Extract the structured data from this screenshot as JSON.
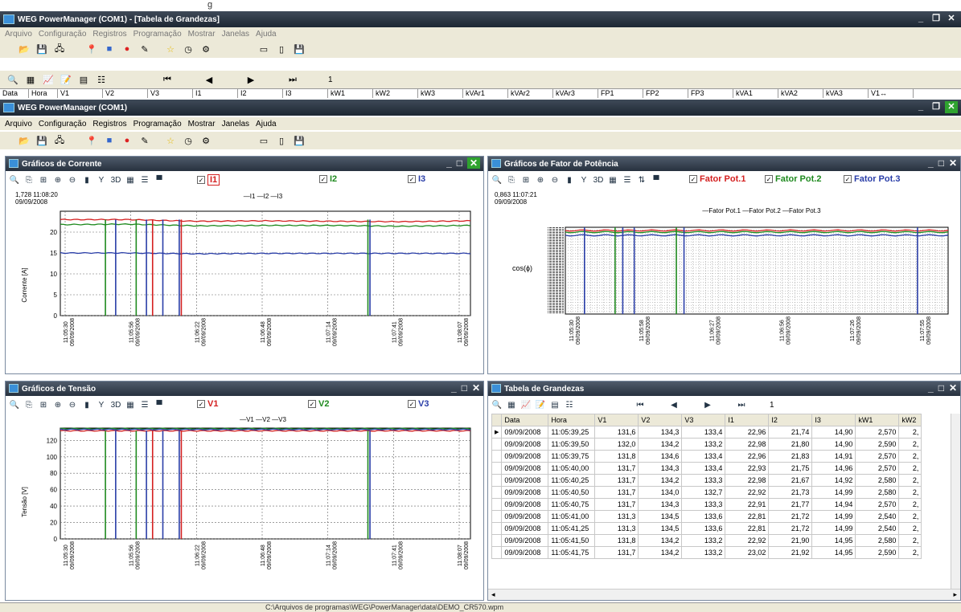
{
  "top_label": "g",
  "outer_window": {
    "title": "WEG PowerManager (COM1) - [Tabela de Grandezas]"
  },
  "outer_menu": [
    "Arquivo",
    "Configuração",
    "Registros",
    "Programação",
    "Mostrar",
    "Janelas",
    "Ajuda"
  ],
  "outer_nav": {
    "page": "1"
  },
  "outer_columns": [
    "Data",
    "Hora",
    "V1",
    "V2",
    "V3",
    "I1",
    "I2",
    "I3",
    "kW1",
    "kW2",
    "kW3",
    "kVAr1",
    "kVAr2",
    "kVAr3",
    "FP1",
    "FP2",
    "FP3",
    "kVA1",
    "kVA2",
    "kVA3",
    "V1↔"
  ],
  "inner_window": {
    "title": "WEG PowerManager (COM1)"
  },
  "inner_menu": [
    "Arquivo",
    "Configuração",
    "Registros",
    "Programação",
    "Mostrar",
    "Janelas",
    "Ajuda"
  ],
  "corrente": {
    "title": "Gráficos de Corrente",
    "checks": [
      "I1",
      "I2",
      "I3"
    ],
    "legend": "—I1 —I2 —I3",
    "readout": "1,728 11:08:20",
    "readout_date": "09/09/2008",
    "ylabel": "Corrente [A]"
  },
  "fp": {
    "title": "Gráficos de Fator de Potência",
    "checks": [
      "Fator Pot.1",
      "Fator Pot.2",
      "Fator Pot.3"
    ],
    "legend": "—Fator Pot.1 —Fator Pot.2 —Fator Pot.3",
    "readout": "0,863 11:07:21",
    "readout_date": "09/09/2008",
    "ylabel": "cos(ϕ)"
  },
  "tensao": {
    "title": "Gráficos de Tensão",
    "checks": [
      "V1",
      "V2",
      "V3"
    ],
    "legend": "—V1 —V2 —V3",
    "ylabel": "Tensão [V]"
  },
  "tabela": {
    "title": "Tabela de Grandezas",
    "page": "1",
    "columns": [
      "Data",
      "Hora",
      "V1",
      "V2",
      "V3",
      "I1",
      "I2",
      "I3",
      "kW1",
      "kW2"
    ],
    "rows": [
      [
        "09/09/2008",
        "11:05:39,25",
        "131,6",
        "134,3",
        "133,4",
        "22,96",
        "21,74",
        "14,90",
        "2,570",
        "2,"
      ],
      [
        "09/09/2008",
        "11:05:39,50",
        "132,0",
        "134,2",
        "133,2",
        "22,98",
        "21,80",
        "14,90",
        "2,590",
        "2,"
      ],
      [
        "09/09/2008",
        "11:05:39,75",
        "131,8",
        "134,6",
        "133,4",
        "22,96",
        "21,83",
        "14,91",
        "2,570",
        "2,"
      ],
      [
        "09/09/2008",
        "11:05:40,00",
        "131,7",
        "134,3",
        "133,4",
        "22,93",
        "21,75",
        "14,96",
        "2,570",
        "2,"
      ],
      [
        "09/09/2008",
        "11:05:40,25",
        "131,7",
        "134,2",
        "133,3",
        "22,98",
        "21,67",
        "14,92",
        "2,580",
        "2,"
      ],
      [
        "09/09/2008",
        "11:05:40,50",
        "131,7",
        "134,0",
        "132,7",
        "22,92",
        "21,73",
        "14,99",
        "2,580",
        "2,"
      ],
      [
        "09/09/2008",
        "11:05:40,75",
        "131,7",
        "134,3",
        "133,3",
        "22,91",
        "21,77",
        "14,94",
        "2,570",
        "2,"
      ],
      [
        "09/09/2008",
        "11:05:41,00",
        "131,3",
        "134,5",
        "133,6",
        "22,81",
        "21,72",
        "14,99",
        "2,540",
        "2,"
      ],
      [
        "09/09/2008",
        "11:05:41,25",
        "131,3",
        "134,5",
        "133,6",
        "22,81",
        "21,72",
        "14,99",
        "2,540",
        "2,"
      ],
      [
        "09/09/2008",
        "11:05:41,50",
        "131,8",
        "134,2",
        "133,2",
        "22,92",
        "21,90",
        "14,95",
        "2,580",
        "2,"
      ],
      [
        "09/09/2008",
        "11:05:41,75",
        "131,7",
        "134,2",
        "133,2",
        "23,02",
        "21,92",
        "14,95",
        "2,590",
        "2,"
      ]
    ]
  },
  "xticks": [
    {
      "time": "11:05:30",
      "date": "09/09/2008"
    },
    {
      "time": "11:05:56",
      "date": "09/09/2008"
    },
    {
      "time": "11:06:22",
      "date": "09/09/2008"
    },
    {
      "time": "11:06:48",
      "date": "09/09/2008"
    },
    {
      "time": "11:07:14",
      "date": "09/09/2008"
    },
    {
      "time": "11:07:41",
      "date": "09/09/2008"
    },
    {
      "time": "11:08:07",
      "date": "09/09/2008"
    }
  ],
  "fp_xticks": [
    {
      "time": "11:05:30",
      "date": "09/09/2008"
    },
    {
      "time": "11:05:58",
      "date": "09/09/2008"
    },
    {
      "time": "11:06:27",
      "date": "09/09/2008"
    },
    {
      "time": "11:06:56",
      "date": "09/09/2008"
    },
    {
      "time": "11:07:26",
      "date": "09/09/2008"
    },
    {
      "time": "11:07:55",
      "date": "09/09/2008"
    }
  ],
  "corrente_yticks": [
    "0",
    "5",
    "10",
    "15",
    "20"
  ],
  "tensao_yticks": [
    "0",
    "20",
    "40",
    "60",
    "80",
    "100",
    "120"
  ],
  "status": {
    "path": "C:\\Arquivos de programas\\WEG\\PowerManager\\data\\DEMO_CR570.wpm"
  },
  "colors": {
    "series1": "#d42020",
    "series2": "#1f8a1f",
    "series3": "#2a3ea8",
    "titlebar": "#27313e"
  },
  "chart_data": [
    {
      "type": "line",
      "ylabel": "Corrente [A]",
      "ylim": [
        0,
        25
      ],
      "x": [
        "11:05:30",
        "11:05:56",
        "11:06:22",
        "11:06:48",
        "11:07:14",
        "11:07:41",
        "11:08:07"
      ],
      "series": [
        {
          "name": "I1",
          "values": [
            23,
            23,
            22.6,
            22.7,
            22.6,
            22.5,
            22.7
          ]
        },
        {
          "name": "I2",
          "values": [
            21.8,
            21.9,
            21.5,
            21.6,
            21.6,
            21.4,
            21.6
          ]
        },
        {
          "name": "I3",
          "values": [
            15,
            15,
            14.8,
            14.9,
            14.9,
            14.9,
            14.9
          ]
        }
      ],
      "grid": true,
      "legend": "top"
    },
    {
      "type": "line",
      "ylabel": "cos(ϕ)",
      "x": [
        "11:05:30",
        "11:05:58",
        "11:06:27",
        "11:06:56",
        "11:07:26",
        "11:07:55"
      ],
      "series": [
        {
          "name": "Fator Pot.1"
        },
        {
          "name": "Fator Pot.2"
        },
        {
          "name": "Fator Pot.3"
        }
      ],
      "grid": true,
      "legend": "top"
    },
    {
      "type": "line",
      "ylabel": "Tensão [V]",
      "ylim": [
        0,
        135
      ],
      "x": [
        "11:05:30",
        "11:05:56",
        "11:06:22",
        "11:06:48",
        "11:07:14",
        "11:07:41",
        "11:08:07"
      ],
      "series": [
        {
          "name": "V1",
          "values": [
            131.7,
            131.7,
            131.6,
            131.7,
            131.6,
            131.7,
            131.7
          ]
        },
        {
          "name": "V2",
          "values": [
            134.3,
            134.3,
            134.2,
            134.3,
            134.2,
            134.3,
            134.2
          ]
        },
        {
          "name": "V3",
          "values": [
            133.3,
            133.3,
            133.2,
            133.3,
            133.2,
            133.3,
            133.3
          ]
        }
      ],
      "grid": true,
      "legend": "top"
    }
  ]
}
